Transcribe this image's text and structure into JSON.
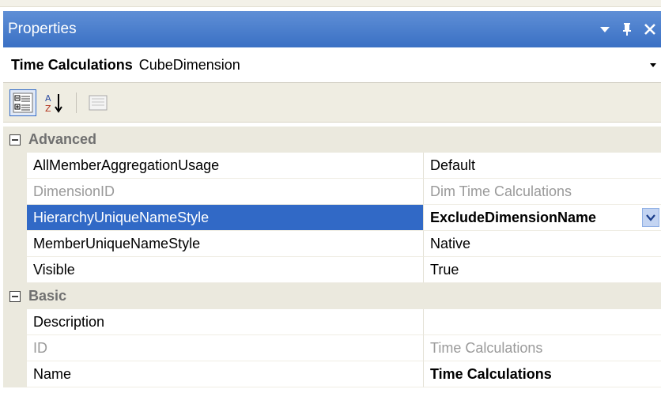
{
  "window": {
    "title": "Properties",
    "icons": [
      "dropdown-arrow-icon",
      "pin-icon",
      "close-icon"
    ]
  },
  "object_selector": {
    "name": "Time Calculations",
    "type": "CubeDimension"
  },
  "toolbar": {
    "buttons": [
      "categorized-icon",
      "alphabetical-icon",
      "property-pages-icon"
    ],
    "active": "categorized-icon"
  },
  "categories": [
    {
      "label": "Advanced",
      "expanded": true,
      "properties": [
        {
          "name": "AllMemberAggregationUsage",
          "value": "Default"
        },
        {
          "name": "DimensionID",
          "value": "Dim Time Calculations"
        },
        {
          "name": "HierarchyUniqueNameStyle",
          "value": "ExcludeDimensionName"
        },
        {
          "name": "MemberUniqueNameStyle",
          "value": "Native"
        },
        {
          "name": "Visible",
          "value": "True"
        }
      ]
    },
    {
      "label": "Basic",
      "expanded": true,
      "properties": [
        {
          "name": "Description",
          "value": ""
        },
        {
          "name": "ID",
          "value": "Time Calculations"
        },
        {
          "name": "Name",
          "value": "Time Calculations"
        }
      ]
    }
  ],
  "selected_property": "HierarchyUniqueNameStyle",
  "colors": {
    "title_bar": "#3a70c4",
    "selection": "#3169c6",
    "category_background": "#ebe9de",
    "disabled_text": "#9a9a9a"
  }
}
